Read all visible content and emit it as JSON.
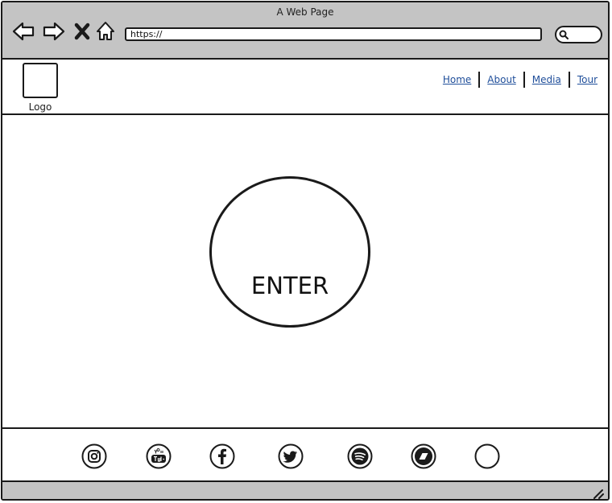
{
  "window": {
    "title": "A Web Page"
  },
  "toolbar": {
    "back_icon": "back-arrow-icon",
    "forward_icon": "forward-arrow-icon",
    "stop_icon": "close-x-icon",
    "home_icon": "home-icon",
    "url": "https://",
    "search_icon": "search-icon"
  },
  "header": {
    "logo_label": "Logo",
    "nav": [
      {
        "label": "Home"
      },
      {
        "label": "About"
      },
      {
        "label": "Media"
      },
      {
        "label": "Tour"
      }
    ],
    "link_color": "#1f4e9a"
  },
  "main": {
    "enter_label": "ENTER"
  },
  "footer": {
    "social_icons": [
      "instagram-icon",
      "youtube-icon",
      "facebook-icon",
      "twitter-icon",
      "spotify-icon",
      "bandcamp-icon",
      "blank-circle-icon"
    ]
  },
  "colors": {
    "chrome": "#c4c4c4",
    "stroke": "#1a1a1a",
    "background": "#ffffff"
  }
}
